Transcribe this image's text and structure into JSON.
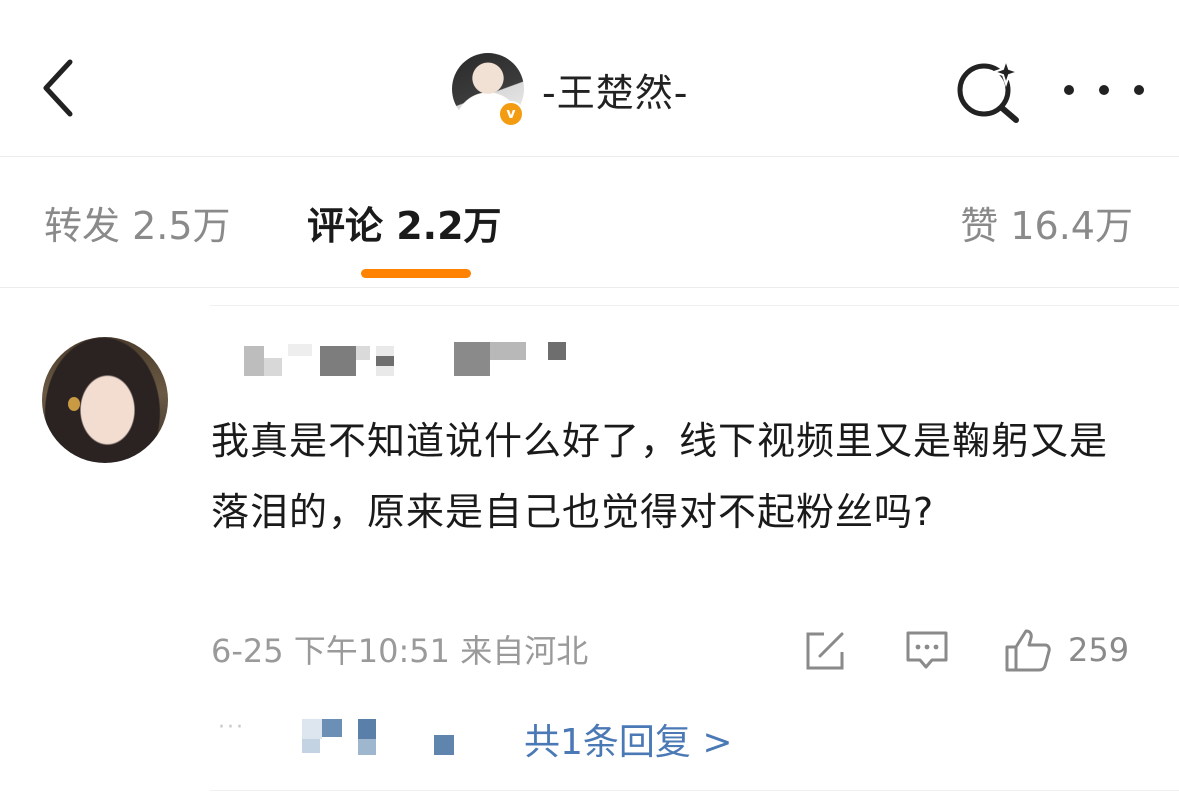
{
  "header": {
    "back_icon": "chevron-left-icon",
    "title": "-王楚然-",
    "verified_badge": "v",
    "search_icon": "search-sparkle-icon",
    "more_icon": "more-horizontal-icon"
  },
  "tabs": {
    "repost": "转发 2.5万",
    "comment": "评论 2.2万",
    "like": "赞 16.4万",
    "active": "comment",
    "accent_color": "#ff8200"
  },
  "comment": {
    "text": "我真是不知道说什么好了，线下视频里又是鞠躬又是落泪的，原来是自己也觉得对不起粉丝吗?",
    "meta": "6-25 下午10:51 来自河北",
    "like_count": "259",
    "reply_link": "共1条回复 >",
    "reply_ellipsis": "···",
    "link_color": "#4a79b6"
  }
}
